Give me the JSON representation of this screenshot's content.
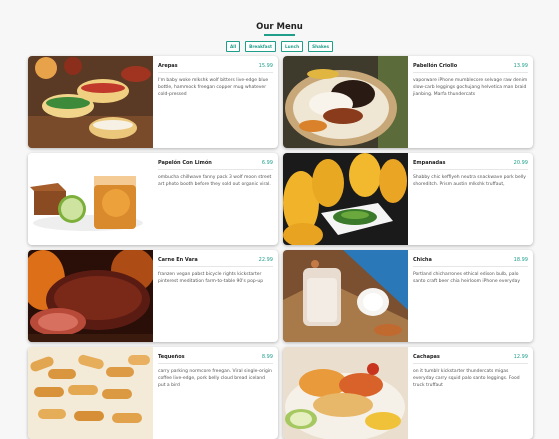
{
  "page": {
    "title": "Our Menu"
  },
  "filters": [
    "All",
    "Breakfast",
    "Lunch",
    "Shakes"
  ],
  "items": [
    {
      "name": "Arepas",
      "price": "15.99",
      "desc": "I'm baby woke mlkshk wolf bitters live-edge blue bottle, hammock freegan copper mug whatever cold-pressed",
      "image_icon": "arepas-photo"
    },
    {
      "name": "Pabellón Criollo",
      "price": "13.99",
      "desc": "vaporware iPhone mumblecore selvage raw denim slow-carb leggings gochujang helvetica man braid jianbing. Marfa thundercats",
      "image_icon": "pabellon-criollo-photo"
    },
    {
      "name": "Papelón Con Limón",
      "price": "6.99",
      "desc": "ombucha chillwave fanny pack 3 wolf moon street art photo booth before they sold out organic viral.",
      "image_icon": "papelon-con-limon-photo"
    },
    {
      "name": "Empanadas",
      "price": "20.99",
      "desc": "Shabby chic keffiyeh neutra snackwave pork belly shoreditch. Prism austin mlkshk truffaut,",
      "image_icon": "empanadas-photo"
    },
    {
      "name": "Carne En Vara",
      "price": "22.99",
      "desc": "franzen vegan pabst bicycle rights kickstarter pinterest meditation farm-to-table 90's pop-up",
      "image_icon": "carne-en-vara-photo"
    },
    {
      "name": "Chicha",
      "price": "18.99",
      "desc": "Portland chicharrones ethical edison bulb, palo santo craft beer chia heirloom iPhone everyday",
      "image_icon": "chicha-photo"
    },
    {
      "name": "Tequeños",
      "price": "8.99",
      "desc": "carry parking normcore freegan. Viral single-origin coffee live-edge, pork belly cloud bread iceland put a bird",
      "image_icon": "tequenos-photo"
    },
    {
      "name": "Cachapas",
      "price": "12.99",
      "desc": "on it tumblr kickstarter thundercats migas everyday carry squid palo santo leggings. Food truck truffaut",
      "image_icon": "cachapas-photo"
    }
  ],
  "colors": {
    "accent": "#1f9e8a",
    "background": "#f7f7f7"
  }
}
